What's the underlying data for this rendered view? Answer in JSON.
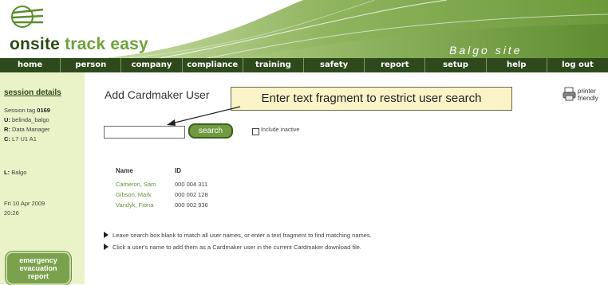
{
  "header": {
    "logo_prefix": "onsite",
    "logo_suffix": "track easy",
    "site_name": "Balgo site"
  },
  "nav": {
    "items": [
      {
        "label": "home"
      },
      {
        "label": "person"
      },
      {
        "label": "company"
      },
      {
        "label": "compliance"
      },
      {
        "label": "training"
      },
      {
        "label": "safety"
      },
      {
        "label": "report"
      },
      {
        "label": "setup"
      },
      {
        "label": "help"
      },
      {
        "label": "log out"
      }
    ]
  },
  "sidebar": {
    "title": "session details",
    "session_tag_label": "Session tag",
    "session_tag_value": "0169",
    "user_label": "U:",
    "user_value": "belinda_balgo",
    "role_label": "R:",
    "role_value": "Data Manager",
    "class_label": "C:",
    "class_value": "L7 U1 A1",
    "location_label": "L:",
    "location_value": "Balgo",
    "date": "Fri 10 Apr 2009",
    "time": "20:26",
    "emergency_line1": "emergency",
    "emergency_line2": "evacuation",
    "emergency_line3": "report"
  },
  "main": {
    "title": "Add Cardmaker User",
    "callout": "Enter text fragment to restrict user search",
    "search_value": "",
    "search_button": "search",
    "include_inactive_label": "Include inactive",
    "include_inactive_checked": false,
    "table": {
      "headers": [
        "Name",
        "ID"
      ],
      "rows": [
        {
          "name": "Cameron, Sam",
          "id": "000 004 311"
        },
        {
          "name": "Gibson, Mark",
          "id": "000 002 128"
        },
        {
          "name": "Vandyk, Fiona",
          "id": "000 002 936"
        }
      ]
    },
    "info": [
      "Leave search box blank to match all user names, or enter a text fragment to find matching names.",
      "Click a user's name to add them as a Cardmaker user in the current Cardmaker download file."
    ],
    "printer_line1": "printer",
    "printer_line2": "friendly"
  }
}
